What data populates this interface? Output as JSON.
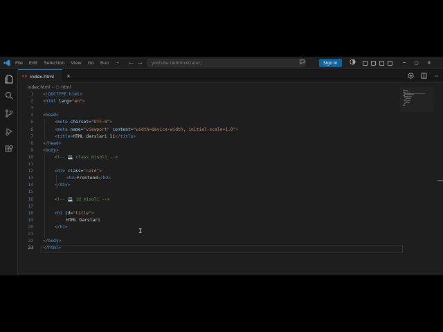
{
  "menu": [
    "File",
    "Edit",
    "Selection",
    "View",
    "Go",
    "Run",
    "···"
  ],
  "title": {
    "nav_back": "←",
    "nav_forward": "→",
    "search_text": "youtube (Administrator)",
    "signin_label": "Sign In"
  },
  "tab": {
    "label": "index.html",
    "close": "×"
  },
  "breadcrumb": {
    "file": "index.html",
    "sep": "›",
    "symbol": "html"
  },
  "editor": {
    "current_line": 23,
    "lines": [
      {
        "n": "1",
        "parts": [
          [
            "t-br",
            "<"
          ],
          [
            "t-tag",
            "!DOCTYPE html"
          ],
          [
            "t-br",
            ">"
          ]
        ],
        "indent": 0
      },
      {
        "n": "2",
        "parts": [
          [
            "t-br",
            "<"
          ],
          [
            "t-tag",
            "html "
          ],
          [
            "t-attr",
            "lang"
          ],
          [
            "t-txt",
            "="
          ],
          [
            "t-str",
            "\"en\""
          ],
          [
            "t-br",
            ">"
          ]
        ],
        "indent": 0
      },
      {
        "n": "3",
        "parts": [],
        "indent": 0
      },
      {
        "n": "4",
        "parts": [
          [
            "t-br",
            "<"
          ],
          [
            "t-tag",
            "head"
          ],
          [
            "t-br",
            ">"
          ]
        ],
        "indent": 0
      },
      {
        "n": "5",
        "parts": [
          [
            "t-br",
            "<"
          ],
          [
            "t-tag",
            "meta "
          ],
          [
            "t-attr",
            "charset"
          ],
          [
            "t-txt",
            "="
          ],
          [
            "t-str",
            "\"UTF-8\""
          ],
          [
            "t-br",
            ">"
          ]
        ],
        "indent": 2
      },
      {
        "n": "6",
        "parts": [
          [
            "t-br",
            "<"
          ],
          [
            "t-tag",
            "meta "
          ],
          [
            "t-attr",
            "name"
          ],
          [
            "t-txt",
            "="
          ],
          [
            "t-str",
            "\"viewport\""
          ],
          [
            "t-txt",
            " "
          ],
          [
            "t-attr",
            "content"
          ],
          [
            "t-txt",
            "="
          ],
          [
            "t-str",
            "\"width=device-width, initial-scale=1.0\""
          ],
          [
            "t-br",
            ">"
          ]
        ],
        "indent": 2
      },
      {
        "n": "7",
        "parts": [
          [
            "t-br",
            "<"
          ],
          [
            "t-tag",
            "title"
          ],
          [
            "t-br",
            ">"
          ],
          [
            "t-txt",
            "HTML darslari 11"
          ],
          [
            "t-br",
            "</"
          ],
          [
            "t-tag",
            "title"
          ],
          [
            "t-br",
            ">"
          ]
        ],
        "indent": 2
      },
      {
        "n": "8",
        "parts": [
          [
            "t-br",
            "</"
          ],
          [
            "t-tag",
            "head"
          ],
          [
            "t-br",
            ">"
          ]
        ],
        "indent": 0
      },
      {
        "n": "9",
        "parts": [
          [
            "t-br",
            "<"
          ],
          [
            "t-tag",
            "body"
          ],
          [
            "t-br",
            ">"
          ]
        ],
        "indent": 0
      },
      {
        "n": "10",
        "parts": [
          [
            "t-cmt",
            "<!-- 💻 class misoli -->"
          ]
        ],
        "indent": 2
      },
      {
        "n": "11",
        "parts": [],
        "indent": 0
      },
      {
        "n": "12",
        "parts": [
          [
            "t-br",
            "<"
          ],
          [
            "t-tag",
            "div "
          ],
          [
            "t-attr",
            "class"
          ],
          [
            "t-txt",
            "="
          ],
          [
            "t-str",
            "\"card\""
          ],
          [
            "t-br",
            ">"
          ]
        ],
        "indent": 2
      },
      {
        "n": "13",
        "parts": [
          [
            "t-br",
            "<"
          ],
          [
            "t-tag",
            "h2"
          ],
          [
            "t-br",
            ">"
          ],
          [
            "t-txt",
            "Frontend"
          ],
          [
            "t-br",
            "</"
          ],
          [
            "t-tag",
            "h2"
          ],
          [
            "t-br",
            ">"
          ]
        ],
        "indent": 4
      },
      {
        "n": "14",
        "parts": [
          [
            "t-br",
            "</"
          ],
          [
            "t-tag",
            "div"
          ],
          [
            "t-br",
            ">"
          ]
        ],
        "indent": 2
      },
      {
        "n": "15",
        "parts": [],
        "indent": 0
      },
      {
        "n": "16",
        "parts": [
          [
            "t-cmt",
            "<!-- 💻 id misoli -->"
          ]
        ],
        "indent": 2
      },
      {
        "n": "17",
        "parts": [],
        "indent": 0
      },
      {
        "n": "18",
        "parts": [
          [
            "t-br",
            "<"
          ],
          [
            "t-tag",
            "h1 "
          ],
          [
            "t-attr",
            "id"
          ],
          [
            "t-txt",
            "="
          ],
          [
            "t-str",
            "\"title\""
          ],
          [
            "t-br",
            ">"
          ]
        ],
        "indent": 2
      },
      {
        "n": "19",
        "parts": [
          [
            "t-txt",
            "HTML Darslari"
          ]
        ],
        "indent": 4
      },
      {
        "n": "20",
        "parts": [
          [
            "t-br",
            "</"
          ],
          [
            "t-tag",
            "h1"
          ],
          [
            "t-br",
            ">"
          ]
        ],
        "indent": 2
      },
      {
        "n": "21",
        "parts": [],
        "indent": 0
      },
      {
        "n": "22",
        "parts": [
          [
            "t-br",
            "</"
          ],
          [
            "t-tag",
            "body"
          ],
          [
            "t-br",
            ">"
          ]
        ],
        "indent": 0
      },
      {
        "n": "23",
        "parts": [
          [
            "t-br",
            "</"
          ],
          [
            "t-tag",
            "html"
          ],
          [
            "t-br",
            ">"
          ]
        ],
        "indent": 0
      }
    ]
  },
  "colors": {
    "accent": "#0078d4",
    "signin": "#0e639c",
    "editor_bg": "#1e1e1e",
    "tag": "#569cd6",
    "attr": "#9cdcfe",
    "string": "#ce9178",
    "comment": "#6a9955"
  },
  "icons": {
    "activity": [
      "explorer-icon",
      "search-icon",
      "source-control-icon",
      "run-debug-icon",
      "extensions-icon"
    ],
    "title": [
      "vscode-logo-icon",
      "copilot-icon",
      "accounts-icon",
      "toggle-panel-icon",
      "toggle-sidebar-icon",
      "customize-layout-icon"
    ],
    "tab": [
      "split-editor-icon",
      "more-actions-icon"
    ]
  }
}
